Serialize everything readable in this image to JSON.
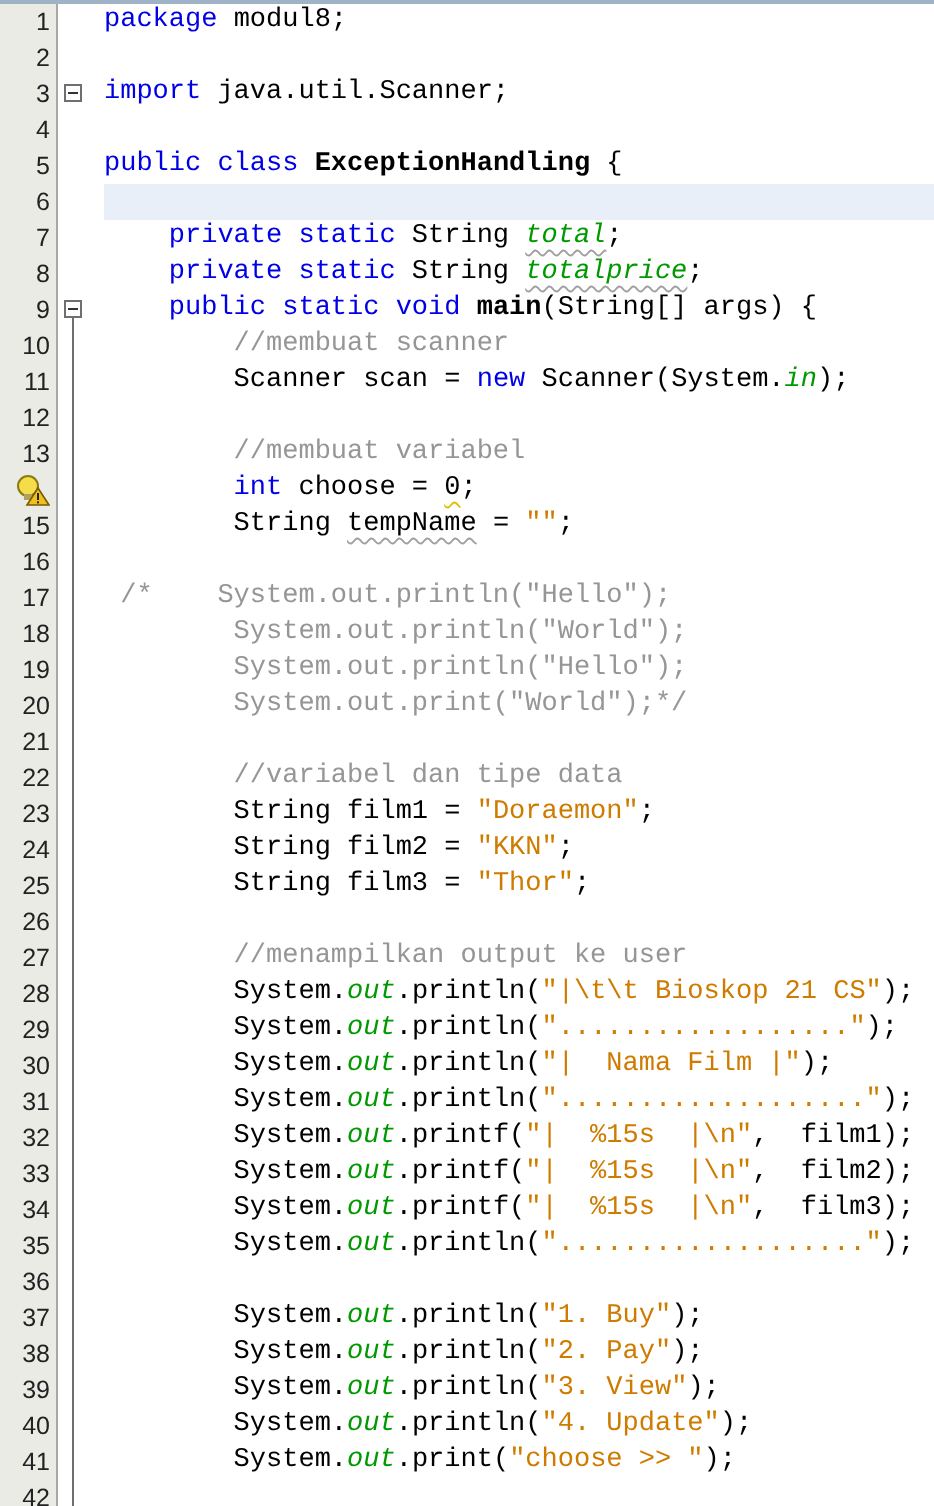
{
  "editor": {
    "lines": [
      {
        "number": "1",
        "tokens": [
          {
            "kind": "keyword",
            "text": "package"
          },
          {
            "kind": "plain",
            "text": " modul8;"
          }
        ]
      },
      {
        "number": "2"
      },
      {
        "number": "3",
        "foldable": true,
        "tokens": [
          {
            "kind": "keyword",
            "text": "import"
          },
          {
            "kind": "plain",
            "text": " java.util.Scanner;"
          }
        ]
      },
      {
        "number": "4"
      },
      {
        "number": "5",
        "tokens": [
          {
            "kind": "keyword",
            "text": "public class "
          },
          {
            "kind": "bold",
            "text": "ExceptionHandling"
          },
          {
            "kind": "plain",
            "text": " {"
          }
        ]
      },
      {
        "number": "6",
        "current": true
      },
      {
        "number": "7",
        "tokens": [
          {
            "kind": "keyword",
            "text": "    private static"
          },
          {
            "kind": "plain",
            "text": " String "
          },
          {
            "kind": "field",
            "text": "total",
            "warning": true
          },
          {
            "kind": "plain",
            "text": ";"
          }
        ]
      },
      {
        "number": "8",
        "tokens": [
          {
            "kind": "keyword",
            "text": "    private static"
          },
          {
            "kind": "plain",
            "text": " String "
          },
          {
            "kind": "field",
            "text": "totalprice",
            "warning": true
          },
          {
            "kind": "plain",
            "text": ";"
          }
        ]
      },
      {
        "number": "9",
        "foldable": true,
        "tokens": [
          {
            "kind": "keyword",
            "text": "    public static void "
          },
          {
            "kind": "bold",
            "text": "main"
          },
          {
            "kind": "plain",
            "text": "(String[] args) {"
          }
        ]
      },
      {
        "number": "10",
        "tokens": [
          {
            "kind": "comment",
            "text": "        //membuat scanner"
          }
        ]
      },
      {
        "number": "11",
        "tokens": [
          {
            "kind": "plain",
            "text": "        Scanner scan = "
          },
          {
            "kind": "keyword",
            "text": "new"
          },
          {
            "kind": "plain",
            "text": " Scanner(System."
          },
          {
            "kind": "field",
            "text": "in"
          },
          {
            "kind": "plain",
            "text": ");"
          }
        ]
      },
      {
        "number": "12"
      },
      {
        "number": "13",
        "tokens": [
          {
            "kind": "comment",
            "text": "        //membuat variabel"
          }
        ]
      },
      {
        "hint": true,
        "tokens": [
          {
            "kind": "keyword",
            "text": "        int"
          },
          {
            "kind": "plain",
            "text": " choose = "
          },
          {
            "kind": "plain",
            "text": "0",
            "hint": true
          },
          {
            "kind": "plain",
            "text": ";"
          }
        ]
      },
      {
        "number": "15",
        "tokens": [
          {
            "kind": "plain",
            "text": "        String "
          },
          {
            "kind": "plain",
            "text": "tempName",
            "warning": true
          },
          {
            "kind": "plain",
            "text": " = "
          },
          {
            "kind": "string",
            "text": "\"\""
          },
          {
            "kind": "plain",
            "text": ";"
          }
        ]
      },
      {
        "number": "16"
      },
      {
        "number": "17",
        "tokens": [
          {
            "kind": "comment",
            "text": " /*    System.out.println(\"Hello\");"
          }
        ]
      },
      {
        "number": "18",
        "tokens": [
          {
            "kind": "comment",
            "text": "        System.out.println(\"World\");"
          }
        ]
      },
      {
        "number": "19",
        "tokens": [
          {
            "kind": "comment",
            "text": "        System.out.println(\"Hello\");"
          }
        ]
      },
      {
        "number": "20",
        "tokens": [
          {
            "kind": "comment",
            "text": "        System.out.print(\"World\");*/"
          }
        ]
      },
      {
        "number": "21"
      },
      {
        "number": "22",
        "tokens": [
          {
            "kind": "comment",
            "text": "        //variabel dan tipe data"
          }
        ]
      },
      {
        "number": "23",
        "tokens": [
          {
            "kind": "plain",
            "text": "        String film1 = "
          },
          {
            "kind": "string",
            "text": "\"Doraemon\""
          },
          {
            "kind": "plain",
            "text": ";"
          }
        ]
      },
      {
        "number": "24",
        "tokens": [
          {
            "kind": "plain",
            "text": "        String film2 = "
          },
          {
            "kind": "string",
            "text": "\"KKN\""
          },
          {
            "kind": "plain",
            "text": ";"
          }
        ]
      },
      {
        "number": "25",
        "tokens": [
          {
            "kind": "plain",
            "text": "        String film3 = "
          },
          {
            "kind": "string",
            "text": "\"Thor\""
          },
          {
            "kind": "plain",
            "text": ";"
          }
        ]
      },
      {
        "number": "26"
      },
      {
        "number": "27",
        "tokens": [
          {
            "kind": "comment",
            "text": "        //menampilkan output ke user"
          }
        ]
      },
      {
        "number": "28",
        "tokens": [
          {
            "kind": "plain",
            "text": "        System."
          },
          {
            "kind": "field",
            "text": "out"
          },
          {
            "kind": "plain",
            "text": ".println("
          },
          {
            "kind": "string",
            "text": "\"|\\t\\t Bioskop 21 CS\""
          },
          {
            "kind": "plain",
            "text": ");"
          }
        ]
      },
      {
        "number": "29",
        "tokens": [
          {
            "kind": "plain",
            "text": "        System."
          },
          {
            "kind": "field",
            "text": "out"
          },
          {
            "kind": "plain",
            "text": ".println("
          },
          {
            "kind": "string",
            "text": "\"..................\""
          },
          {
            "kind": "plain",
            "text": ");"
          }
        ]
      },
      {
        "number": "30",
        "tokens": [
          {
            "kind": "plain",
            "text": "        System."
          },
          {
            "kind": "field",
            "text": "out"
          },
          {
            "kind": "plain",
            "text": ".println("
          },
          {
            "kind": "string",
            "text": "\"|  Nama Film |\""
          },
          {
            "kind": "plain",
            "text": ");"
          }
        ]
      },
      {
        "number": "31",
        "tokens": [
          {
            "kind": "plain",
            "text": "        System."
          },
          {
            "kind": "field",
            "text": "out"
          },
          {
            "kind": "plain",
            "text": ".println("
          },
          {
            "kind": "string",
            "text": "\"...................\""
          },
          {
            "kind": "plain",
            "text": ");"
          }
        ]
      },
      {
        "number": "32",
        "tokens": [
          {
            "kind": "plain",
            "text": "        System."
          },
          {
            "kind": "field",
            "text": "out"
          },
          {
            "kind": "plain",
            "text": ".printf("
          },
          {
            "kind": "string",
            "text": "\"|  %15s  |\\n\""
          },
          {
            "kind": "plain",
            "text": ",  film1);"
          }
        ]
      },
      {
        "number": "33",
        "tokens": [
          {
            "kind": "plain",
            "text": "        System."
          },
          {
            "kind": "field",
            "text": "out"
          },
          {
            "kind": "plain",
            "text": ".printf("
          },
          {
            "kind": "string",
            "text": "\"|  %15s  |\\n\""
          },
          {
            "kind": "plain",
            "text": ",  film2);"
          }
        ]
      },
      {
        "number": "34",
        "tokens": [
          {
            "kind": "plain",
            "text": "        System."
          },
          {
            "kind": "field",
            "text": "out"
          },
          {
            "kind": "plain",
            "text": ".printf("
          },
          {
            "kind": "string",
            "text": "\"|  %15s  |\\n\""
          },
          {
            "kind": "plain",
            "text": ",  film3);"
          }
        ]
      },
      {
        "number": "35",
        "tokens": [
          {
            "kind": "plain",
            "text": "        System."
          },
          {
            "kind": "field",
            "text": "out"
          },
          {
            "kind": "plain",
            "text": ".println("
          },
          {
            "kind": "string",
            "text": "\"...................\""
          },
          {
            "kind": "plain",
            "text": ");"
          }
        ]
      },
      {
        "number": "36"
      },
      {
        "number": "37",
        "tokens": [
          {
            "kind": "plain",
            "text": "        System."
          },
          {
            "kind": "field",
            "text": "out"
          },
          {
            "kind": "plain",
            "text": ".println("
          },
          {
            "kind": "string",
            "text": "\"1. Buy\""
          },
          {
            "kind": "plain",
            "text": ");"
          }
        ]
      },
      {
        "number": "38",
        "tokens": [
          {
            "kind": "plain",
            "text": "        System."
          },
          {
            "kind": "field",
            "text": "out"
          },
          {
            "kind": "plain",
            "text": ".println("
          },
          {
            "kind": "string",
            "text": "\"2. Pay\""
          },
          {
            "kind": "plain",
            "text": ");"
          }
        ]
      },
      {
        "number": "39",
        "tokens": [
          {
            "kind": "plain",
            "text": "        System."
          },
          {
            "kind": "field",
            "text": "out"
          },
          {
            "kind": "plain",
            "text": ".println("
          },
          {
            "kind": "string",
            "text": "\"3. View\""
          },
          {
            "kind": "plain",
            "text": ");"
          }
        ]
      },
      {
        "number": "40",
        "tokens": [
          {
            "kind": "plain",
            "text": "        System."
          },
          {
            "kind": "field",
            "text": "out"
          },
          {
            "kind": "plain",
            "text": ".println("
          },
          {
            "kind": "string",
            "text": "\"4. Update\""
          },
          {
            "kind": "plain",
            "text": ");"
          }
        ]
      },
      {
        "number": "41",
        "tokens": [
          {
            "kind": "plain",
            "text": "        System."
          },
          {
            "kind": "field",
            "text": "out"
          },
          {
            "kind": "plain",
            "text": ".print("
          },
          {
            "kind": "string",
            "text": "\"choose >> \""
          },
          {
            "kind": "plain",
            "text": ");"
          }
        ]
      },
      {
        "number": "42"
      }
    ]
  }
}
